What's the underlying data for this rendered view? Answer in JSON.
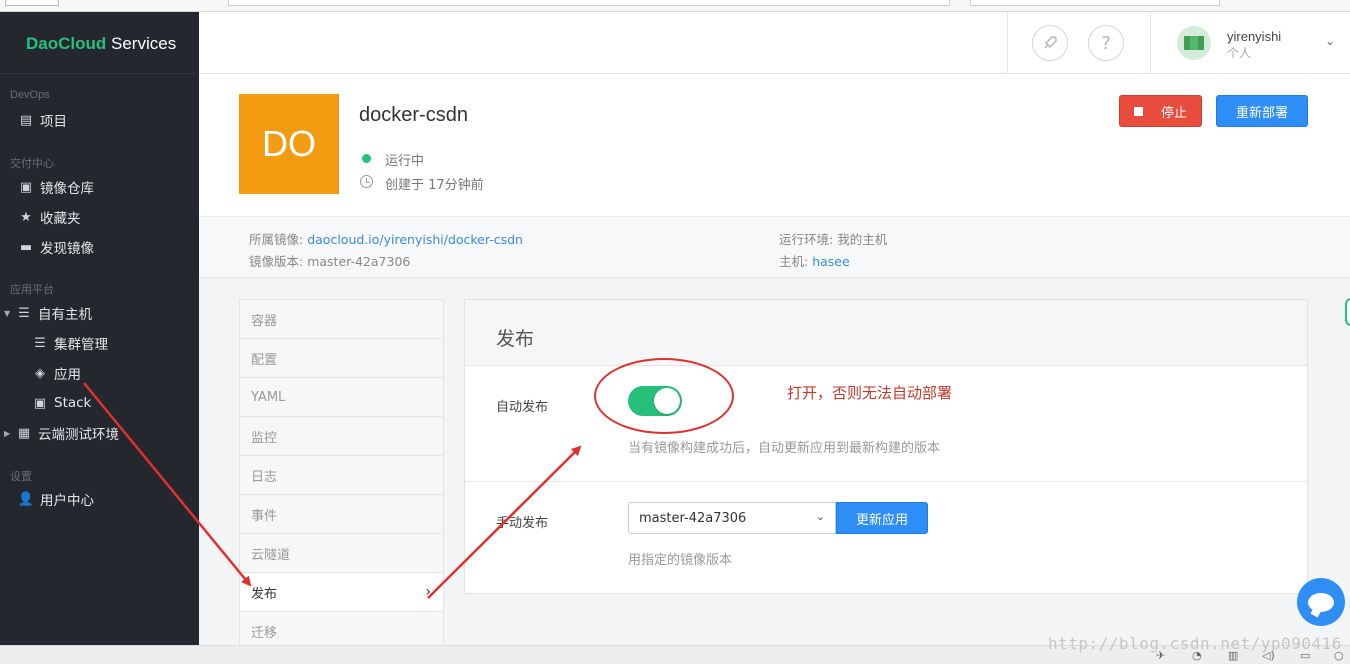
{
  "brand": {
    "name_part1": "DaoCloud",
    "name_part2": " Services"
  },
  "sidebar": {
    "sections": [
      {
        "title": "DevOps"
      },
      {
        "title": "交付中心"
      },
      {
        "title": "应用平台"
      },
      {
        "title": "设置"
      }
    ],
    "items": [
      {
        "label": "项目",
        "icon": "project-icon"
      },
      {
        "label": "镜像仓库",
        "icon": "registry-icon"
      },
      {
        "label": "收藏夹",
        "icon": "star-icon"
      },
      {
        "label": "发现镜像",
        "icon": "discover-icon"
      },
      {
        "label": "自有主机",
        "icon": "host-icon"
      },
      {
        "label": "集群管理",
        "icon": "cluster-icon"
      },
      {
        "label": "应用",
        "icon": "layers-icon"
      },
      {
        "label": "Stack",
        "icon": "stack-icon"
      },
      {
        "label": "云端测试环境",
        "icon": "clipboard-icon"
      },
      {
        "label": "用户中心",
        "icon": "user-icon"
      }
    ]
  },
  "topbar": {
    "rocket_icon": "rocket-icon",
    "help_label": "?",
    "user_name": "yirenyishi",
    "user_type": "个人"
  },
  "app": {
    "logo_text": "DO",
    "name": "docker-csdn",
    "status": "运行中",
    "created": "创建于 17分钟前",
    "stop_label": "停止",
    "redeploy_label": "重新部署",
    "colors": {
      "logo": "#f39c12",
      "running": "#27c07a",
      "stop": "#e74c3c",
      "primary": "#2e8ef5"
    }
  },
  "meta": {
    "image_label": "所属镜像:",
    "image_value": "daocloud.io/yirenyishi/docker-csdn",
    "version_label": "镜像版本:",
    "version_value": "master-42a7306",
    "env_label": "运行环境:",
    "env_value": "我的主机",
    "host_label": "主机:",
    "host_value": "hasee"
  },
  "tabs": [
    {
      "label": "容器"
    },
    {
      "label": "配置"
    },
    {
      "label": "YAML"
    },
    {
      "label": "监控"
    },
    {
      "label": "日志"
    },
    {
      "label": "事件"
    },
    {
      "label": "云隧道"
    },
    {
      "label": "发布",
      "active": true
    },
    {
      "label": "迁移"
    }
  ],
  "publish": {
    "title": "发布",
    "auto_label": "自动发布",
    "auto_enabled": true,
    "auto_hint": "当有镜像构建成功后，自动更新应用到最新构建的版本",
    "manual_label": "手动发布",
    "selected_version": "master-42a7306",
    "update_label": "更新应用",
    "manual_hint": "用指定的镜像版本"
  },
  "annotation": {
    "text": "打开，否则无法自动部署",
    "color": "#e03131"
  },
  "watermark": "http://blog.csdn.net/yp090416"
}
